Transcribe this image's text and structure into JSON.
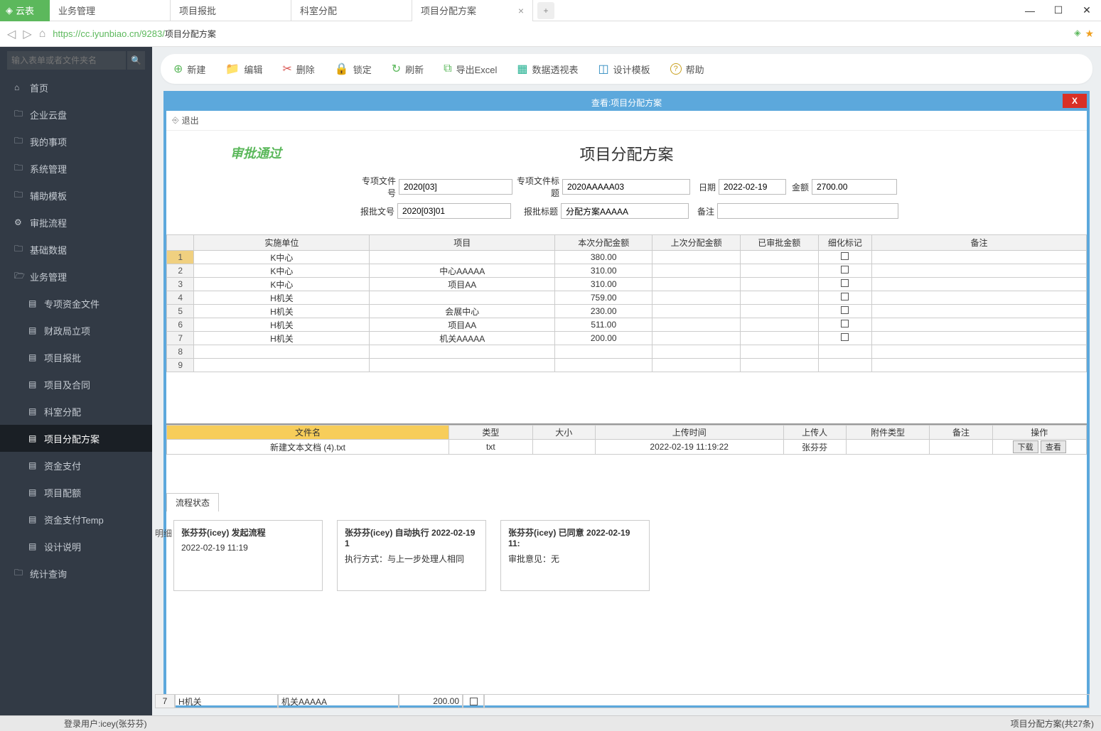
{
  "brand": "云表",
  "top_tabs": [
    {
      "label": "业务管理",
      "closable": false
    },
    {
      "label": "项目报批",
      "closable": false
    },
    {
      "label": "科室分配",
      "closable": false
    },
    {
      "label": "项目分配方案",
      "closable": true,
      "active": true
    }
  ],
  "url_host": "https://cc.iyunbiao.cn/9283/",
  "url_path": "项目分配方案",
  "search_placeholder": "输入表单或者文件夹名",
  "sidebar": {
    "items": [
      {
        "icon": "home",
        "label": "首页"
      },
      {
        "icon": "folder",
        "label": "企业云盘"
      },
      {
        "icon": "folder",
        "label": "我的事项"
      },
      {
        "icon": "folder",
        "label": "系统管理"
      },
      {
        "icon": "folder",
        "label": "辅助模板"
      },
      {
        "icon": "flow",
        "label": "审批流程"
      },
      {
        "icon": "folder",
        "label": "基础数据"
      },
      {
        "icon": "folder-open",
        "label": "业务管理"
      }
    ],
    "subs": [
      {
        "label": "专项资金文件"
      },
      {
        "label": "财政局立项"
      },
      {
        "label": "项目报批"
      },
      {
        "label": "项目及合同"
      },
      {
        "label": "科室分配"
      },
      {
        "label": "项目分配方案",
        "active": true
      },
      {
        "label": "资金支付"
      },
      {
        "label": "项目配额"
      },
      {
        "label": "资金支付Temp"
      },
      {
        "label": "设计说明"
      }
    ],
    "footer": {
      "icon": "folder",
      "label": "统计查询"
    }
  },
  "toolbar": [
    {
      "name": "new",
      "icon": "⊕",
      "cls": "ic-green",
      "label": "新建"
    },
    {
      "name": "edit",
      "icon": "📁",
      "cls": "ic-orange",
      "label": "编辑"
    },
    {
      "name": "delete",
      "icon": "✂",
      "cls": "ic-red",
      "label": "删除"
    },
    {
      "name": "lock",
      "icon": "🔒",
      "cls": "ic-gold",
      "label": "锁定"
    },
    {
      "name": "refresh",
      "icon": "↻",
      "cls": "ic-green",
      "label": "刷新"
    },
    {
      "name": "export",
      "icon": "⧉",
      "cls": "ic-green",
      "label": "导出Excel"
    },
    {
      "name": "pivot",
      "icon": "▦",
      "cls": "ic-teal",
      "label": "数据透视表"
    },
    {
      "name": "design",
      "icon": "◫",
      "cls": "ic-blue",
      "label": "设计模板"
    },
    {
      "name": "help",
      "icon": "?",
      "cls": "ic-gold",
      "label": "帮助"
    }
  ],
  "modal": {
    "title": "查看:项目分配方案",
    "exit": "退出",
    "approve": "审批通过",
    "form_title": "项目分配方案",
    "fields": {
      "special_file_no": {
        "label": "专项文件号",
        "value": "2020[03]"
      },
      "special_file_title": {
        "label": "专项文件标题",
        "value": "2020AAAAA03"
      },
      "date": {
        "label": "日期",
        "value": "2022-02-19"
      },
      "amount": {
        "label": "金额",
        "value": "2700.00"
      },
      "approve_no": {
        "label": "报批文号",
        "value": "2020[03]01"
      },
      "approve_title": {
        "label": "报批标题",
        "value": "分配方案AAAAA"
      },
      "remark": {
        "label": "备注",
        "value": ""
      }
    },
    "detail_headers": [
      "实施单位",
      "项目",
      "本次分配金额",
      "上次分配金额",
      "已审批金额",
      "细化标记",
      "备注"
    ],
    "detail_rows": [
      {
        "n": "1",
        "unit": "K中心",
        "project": "",
        "this_amt": "380.00"
      },
      {
        "n": "2",
        "unit": "K中心",
        "project": "中心AAAAA",
        "this_amt": "310.00"
      },
      {
        "n": "3",
        "unit": "K中心",
        "project": "项目AA",
        "this_amt": "310.00"
      },
      {
        "n": "4",
        "unit": "H机关",
        "project": "",
        "this_amt": "759.00"
      },
      {
        "n": "5",
        "unit": "H机关",
        "project": "会展中心",
        "this_amt": "230.00"
      },
      {
        "n": "6",
        "unit": "H机关",
        "project": "项目AA",
        "this_amt": "511.00"
      },
      {
        "n": "7",
        "unit": "H机关",
        "project": "机关AAAAA",
        "this_amt": "200.00"
      },
      {
        "n": "8",
        "unit": "",
        "project": "",
        "this_amt": ""
      },
      {
        "n": "9",
        "unit": "",
        "project": "",
        "this_amt": ""
      }
    ],
    "attach_headers": [
      "文件名",
      "类型",
      "大小",
      "上传时间",
      "上传人",
      "附件类型",
      "备注",
      "操作"
    ],
    "attach_row": {
      "filename": "新建文本文档 (4).txt",
      "type": "txt",
      "size": "",
      "uploaded_at": "2022-02-19 11:19:22",
      "uploader": "张芬芬",
      "attach_type": "",
      "remark": "",
      "ops": {
        "download": "下载",
        "view": "查看"
      }
    },
    "workflow_tab": "流程状态",
    "workflow_cards": [
      {
        "hd": "张芬芬(icey)  发起流程",
        "body": "2022-02-19 11:19"
      },
      {
        "hd": "张芬芬(icey) 自动执行 2022-02-19 1",
        "body": "执行方式：与上一步处理人相同"
      },
      {
        "hd": "张芬芬(icey) 已同意 2022-02-19 11:",
        "body": "审批意见：无"
      }
    ]
  },
  "below_hint": "明细",
  "below_row": {
    "n": "7",
    "unit": "H机关",
    "project": "机关AAAAA",
    "amt": "200.00"
  },
  "status": {
    "user": "登录用户:icey(张芬芬)",
    "right": "项目分配方案(共27条)"
  }
}
